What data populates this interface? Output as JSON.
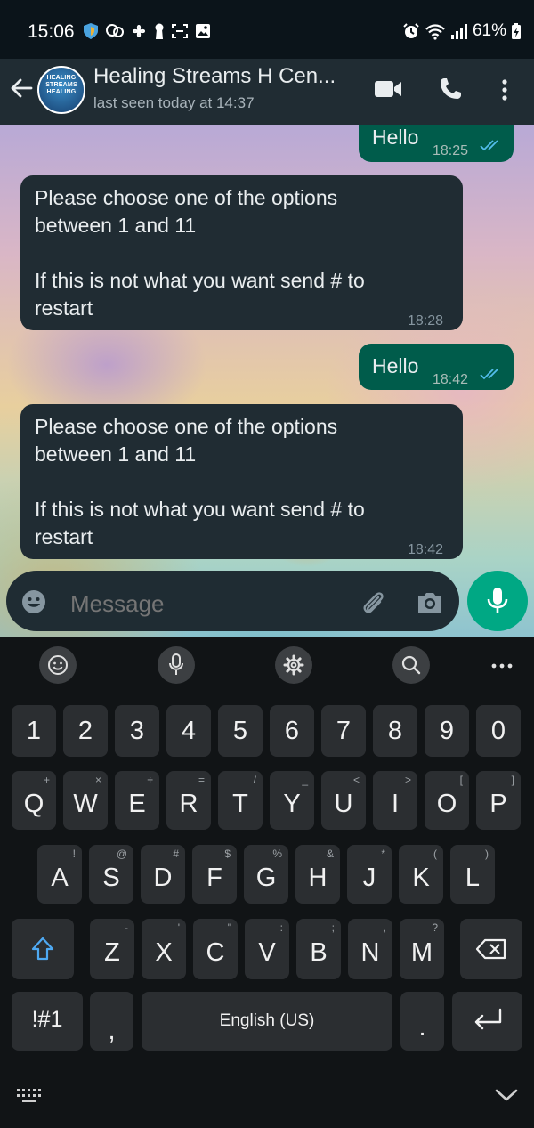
{
  "status_bar": {
    "time": "15:06",
    "battery": "61%"
  },
  "header": {
    "avatar_text": "HEALING STREAMS HEALING",
    "title": "Healing Streams H Cen...",
    "subtitle": "last seen today at 14:37"
  },
  "messages": [
    {
      "direction": "out",
      "text": "Hello",
      "time": "18:25"
    },
    {
      "direction": "in",
      "text": "Please choose one of the options\nbetween 1 and 11\n\nIf this is not what you want send # to\nrestart",
      "time": "18:28"
    },
    {
      "direction": "out",
      "text": "Hello",
      "time": "18:42"
    },
    {
      "direction": "in",
      "text": "Please choose one of the options\nbetween 1 and 11\n\nIf this is not what you want send # to\nrestart",
      "time": "18:42"
    }
  ],
  "composer": {
    "placeholder": "Message"
  },
  "keyboard": {
    "number_row": [
      "1",
      "2",
      "3",
      "4",
      "5",
      "6",
      "7",
      "8",
      "9",
      "0"
    ],
    "row1": [
      "Q",
      "W",
      "E",
      "R",
      "T",
      "Y",
      "U",
      "I",
      "O",
      "P"
    ],
    "row1_sup": [
      "+",
      "×",
      "÷",
      "=",
      "/",
      "_",
      "<",
      ">",
      "[",
      "]"
    ],
    "row2": [
      "A",
      "S",
      "D",
      "F",
      "G",
      "H",
      "J",
      "K",
      "L"
    ],
    "row2_sup": [
      "!",
      "@",
      "#",
      "$",
      "%",
      "&",
      "*",
      "(",
      ")"
    ],
    "row3": [
      "Z",
      "X",
      "C",
      "V",
      "B",
      "N",
      "M"
    ],
    "row3_sup": [
      "-",
      "'",
      "\"",
      ":",
      ";",
      ",",
      "?"
    ],
    "symbols_key": "!#1",
    "comma_key": ",",
    "space_label": "English (US)",
    "period_key": "."
  },
  "colors": {
    "header_bg": "#202c33",
    "incoming_bubble": "#202c33",
    "outgoing_bubble": "#005c4b",
    "accent": "#00a884",
    "read_ticks": "#53bdeb"
  }
}
